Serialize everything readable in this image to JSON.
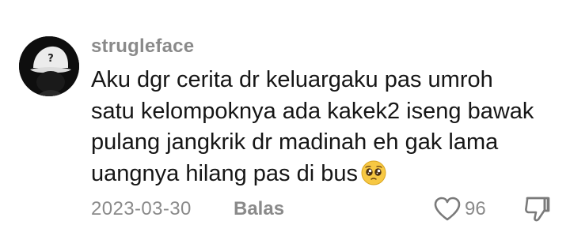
{
  "comment": {
    "username": "strugleface",
    "text_lines": [
      "Aku dgr cerita dr keluargaku pas umroh",
      "satu kelompoknya ada kakek2 iseng bawak",
      "pulang jangkrik dr madinah eh gak lama",
      "uangnya hilang pas di bus"
    ],
    "emoji": "pleading-face",
    "date": "2023-03-30",
    "reply_label": "Balas",
    "like_count": "96",
    "like_icon": "heart-outline-icon",
    "dislike_icon": "thumbs-down-outline-icon"
  },
  "colors": {
    "username": "#8a8a8a",
    "text": "#161616",
    "meta": "#8a8a8a",
    "background": "#ffffff"
  }
}
